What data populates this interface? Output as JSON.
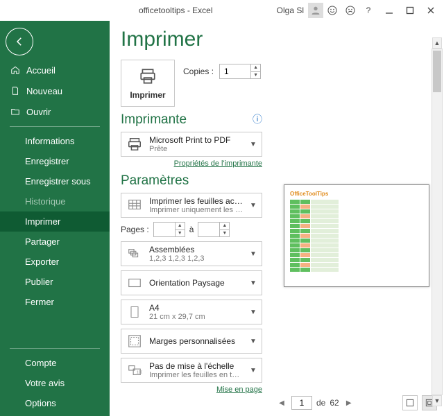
{
  "window": {
    "title": "officetooltips - Excel",
    "user": "Olga Sl"
  },
  "sidebar": {
    "top": [
      {
        "icon": "home",
        "label": "Accueil"
      },
      {
        "icon": "new",
        "label": "Nouveau"
      },
      {
        "icon": "open",
        "label": "Ouvrir"
      }
    ],
    "middle": [
      {
        "label": "Informations"
      },
      {
        "label": "Enregistrer"
      },
      {
        "label": "Enregistrer sous"
      },
      {
        "label": "Historique",
        "disabled": true
      },
      {
        "label": "Imprimer",
        "selected": true
      },
      {
        "label": "Partager"
      },
      {
        "label": "Exporter"
      },
      {
        "label": "Publier"
      },
      {
        "label": "Fermer"
      }
    ],
    "bottom": [
      {
        "label": "Compte"
      },
      {
        "label": "Votre avis"
      },
      {
        "label": "Options"
      }
    ]
  },
  "print": {
    "heading": "Imprimer",
    "button_label": "Imprimer",
    "copies_label": "Copies :",
    "copies_value": "1",
    "printer_heading": "Imprimante",
    "printer_name": "Microsoft Print to PDF",
    "printer_status": "Prête",
    "printer_props": "Propriétés de l'imprimante",
    "settings_heading": "Paramètres",
    "scope": {
      "title": "Imprimer les feuilles actives",
      "sub": "Imprimer uniquement les fe…"
    },
    "pages_label": "Pages :",
    "pages_from": "",
    "pages_to_label": "à",
    "pages_to": "",
    "collate": {
      "title": "Assemblées",
      "sub": "1,2,3    1,2,3    1,2,3"
    },
    "orientation": {
      "title": "Orientation Paysage",
      "sub": ""
    },
    "paper": {
      "title": "A4",
      "sub": "21 cm x 29,7 cm"
    },
    "margins": {
      "title": "Marges personnalisées",
      "sub": ""
    },
    "scaling": {
      "title": "Pas de mise à l'échelle",
      "sub": "Imprimer les feuilles en taill…"
    },
    "page_setup": "Mise en page"
  },
  "preview": {
    "doc_title": "OfficeToolTips",
    "page_current": "1",
    "page_of_label": "de",
    "page_total": "62"
  }
}
